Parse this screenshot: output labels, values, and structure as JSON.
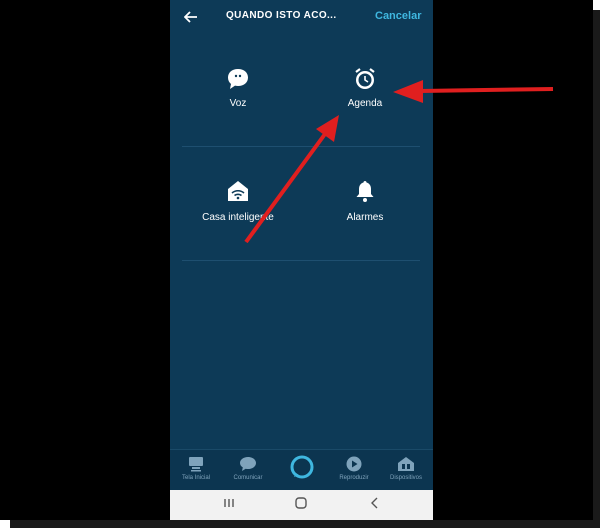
{
  "header": {
    "title": "QUANDO ISTO ACO...",
    "cancel_label": "Cancelar"
  },
  "tiles": [
    {
      "label": "Voz",
      "icon": "speech-bubble-icon"
    },
    {
      "label": "Agenda",
      "icon": "alarm-clock-icon"
    },
    {
      "label": "Casa inteligente",
      "icon": "smart-home-icon"
    },
    {
      "label": "Alarmes",
      "icon": "bell-icon"
    }
  ],
  "bottom_nav": [
    {
      "label": "Tela Inicial",
      "icon": "home-screen-icon"
    },
    {
      "label": "Comunicar",
      "icon": "chat-icon"
    },
    {
      "label": "",
      "icon": "alexa-ring-icon"
    },
    {
      "label": "Reproduzir",
      "icon": "play-icon"
    },
    {
      "label": "Dispositivos",
      "icon": "devices-icon"
    }
  ],
  "system_nav": [
    "recent-apps-icon",
    "home-icon",
    "back-icon"
  ],
  "colors": {
    "background": "#0d3a57",
    "accent": "#3fb7e0",
    "annotation_arrow": "#e01f1f"
  }
}
